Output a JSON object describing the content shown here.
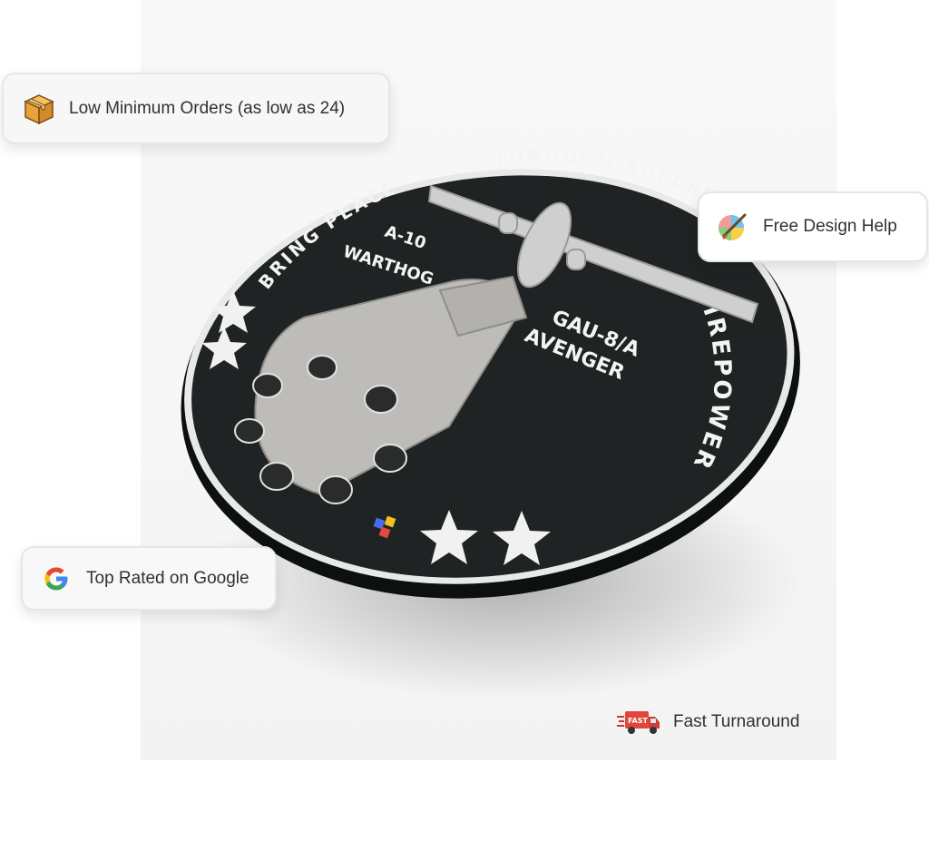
{
  "badges": {
    "min_orders": {
      "label": "Low Minimum Orders (as low as 24)",
      "icon": "package-box-icon"
    },
    "design_help": {
      "label": "Free Design Help",
      "icon": "palette-brush-icon"
    },
    "google": {
      "label": "Top Rated on Google",
      "icon": "google-g-icon"
    },
    "turnaround": {
      "label": "Fast Turnaround",
      "icon": "fast-delivery-truck-icon",
      "truck_text": "FAST"
    }
  },
  "patch": {
    "top_left_text": "BRING PEACE",
    "top_right_text": "THROUGH SUPERIOR",
    "side_text": "FIREPOWER",
    "aircraft_line1": "A-10",
    "aircraft_line2": "WARTHOG",
    "gun_line1": "GAU-8/A",
    "gun_line2": "AVENGER"
  },
  "colors": {
    "patch_face": "#1f2323",
    "patch_edge": "#111414",
    "gun_gray": "#bdbcb8",
    "badge_text": "#2f3133",
    "google_blue": "#4285F4",
    "google_red": "#EA4335",
    "google_yellow": "#FBBC05",
    "google_green": "#34A853"
  }
}
